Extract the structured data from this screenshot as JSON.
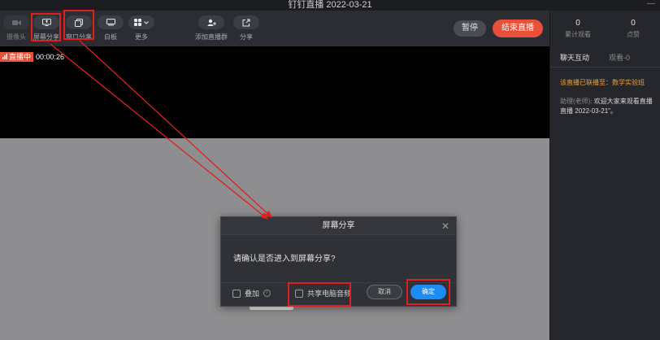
{
  "window": {
    "title": "钉钉直播 2022-03-21",
    "minimize_glyph": "—"
  },
  "toolbar": {
    "items": [
      {
        "label": "摄像头",
        "icon": "camera-icon"
      },
      {
        "label": "屏幕分享",
        "icon": "screen-share-icon"
      },
      {
        "label": "窗口分享",
        "icon": "window-share-icon"
      },
      {
        "label": "白板",
        "icon": "whiteboard-icon"
      },
      {
        "label": "更多",
        "icon": "more-grid-icon"
      },
      {
        "label": "添加直播群",
        "icon": "add-group-icon"
      },
      {
        "label": "分享",
        "icon": "share-icon"
      }
    ],
    "pause_label": "暂停",
    "end_label": "结束直播"
  },
  "video": {
    "live_tag": "直播中",
    "elapsed": "00:00:26"
  },
  "dialog": {
    "title": "屏幕分享",
    "close_glyph": "✕",
    "message": "请确认是否进入到屏幕分享?",
    "overlay_label": "叠加",
    "info_glyph": "i",
    "share_audio_label": "共享电脑音频",
    "cancel_label": "取消",
    "confirm_label": "确定"
  },
  "sidebar": {
    "stats": [
      {
        "value": "0",
        "label": "累计观看"
      },
      {
        "value": "0",
        "label": "点赞"
      }
    ],
    "tabs": [
      "聊天互动",
      "观看-0"
    ],
    "notice": "该直播已联播至：数学实验班",
    "chat": {
      "sender": "助理(老师):",
      "text": "欢迎大家来观看直播 直播 2022-03-21\"。"
    }
  },
  "colors": {
    "accent": "#e8503a",
    "primary": "#1c8cf2",
    "annotation": "#e01f1f",
    "notice": "#e8a23a"
  }
}
